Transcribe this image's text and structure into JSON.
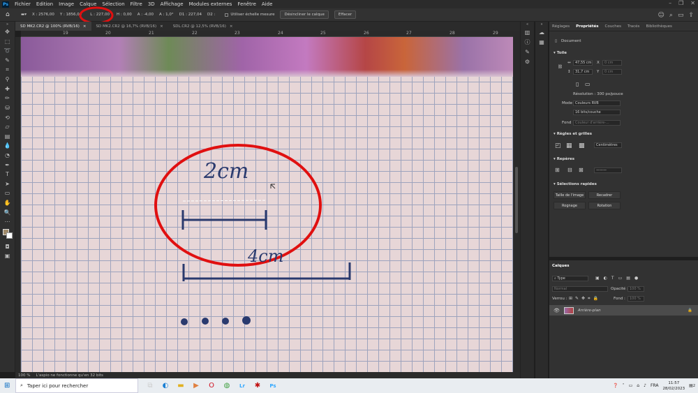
{
  "menu": {
    "logo": "Ps",
    "items": [
      "Fichier",
      "Edition",
      "Image",
      "Calque",
      "Sélection",
      "Filtre",
      "3D",
      "Affichage",
      "Modules externes",
      "Fenêtre",
      "Aide"
    ]
  },
  "options": {
    "x": "X : 2576,00",
    "y": "Y : 1856,00",
    "l": "L : 227,00",
    "h": "H : 0,00",
    "angle": "A : -4,00",
    "a2": "A : 1,0°",
    "d1": "D1 : 227,04",
    "d2": "D2 :",
    "use_scale": "Utiliser échelle mesure",
    "unstraighten": "Désincliner le calque",
    "clear": "Effacer"
  },
  "tabs": [
    "SD MK2.CR2 @ 100% (RVB/16)",
    "SD MK2.CR2 @ 16,7% (RVB/16)",
    "SDL.CR2 @ 12,5% (RVB/16)"
  ],
  "ruler": [
    "19",
    "20",
    "21",
    "22",
    "23",
    "24",
    "25",
    "26",
    "27",
    "28",
    "29"
  ],
  "canvas": {
    "label1": "2cm",
    "label2": "4cm",
    "highlight_color": "#e01010"
  },
  "status": {
    "zoom": "100 %",
    "message": "L'aspio ne fonctionne qu'en 32 bits"
  },
  "properties": {
    "tabs": [
      "Réglages",
      "Propriétés",
      "Couches",
      "Tracés",
      "Bibliothèques"
    ],
    "active_tab": "Propriétés",
    "doc_label": "Document",
    "canvas_title": "Toile",
    "width": "47,55 cm",
    "height": "31,7 cm",
    "x_label": "X",
    "y_label": "Y",
    "x_val": "0 cm",
    "y_val": "0 cm",
    "resolution": "Résolution : 300 px/pouce",
    "mode_label": "Mode",
    "mode_val": "Couleurs RVB",
    "depth_val": "16 bits/couche",
    "fond_label": "Fond",
    "fond_val": "Couleur d'arrière-...",
    "rulers_title": "Règles et grilles",
    "units": "Centimètres",
    "guides_title": "Repères",
    "quick_title": "Sélections rapides",
    "btn_size": "Taille de l'image",
    "btn_crop": "Recadrer",
    "btn_trim": "Rognage",
    "btn_rotate": "Rotation"
  },
  "layers": {
    "title": "Calques",
    "filter": "Type",
    "blend": "Normal",
    "opacity_label": "Opacité :",
    "opacity": "100 %",
    "lock_label": "Verrou :",
    "fill_label": "Fond :",
    "fill": "100 %",
    "layer_name": "Arrière-plan"
  },
  "taskbar": {
    "search": "Taper ici pour rechercher",
    "lang": "FRA",
    "time": "11:57",
    "date": "28/02/2023",
    "notif": "2"
  }
}
